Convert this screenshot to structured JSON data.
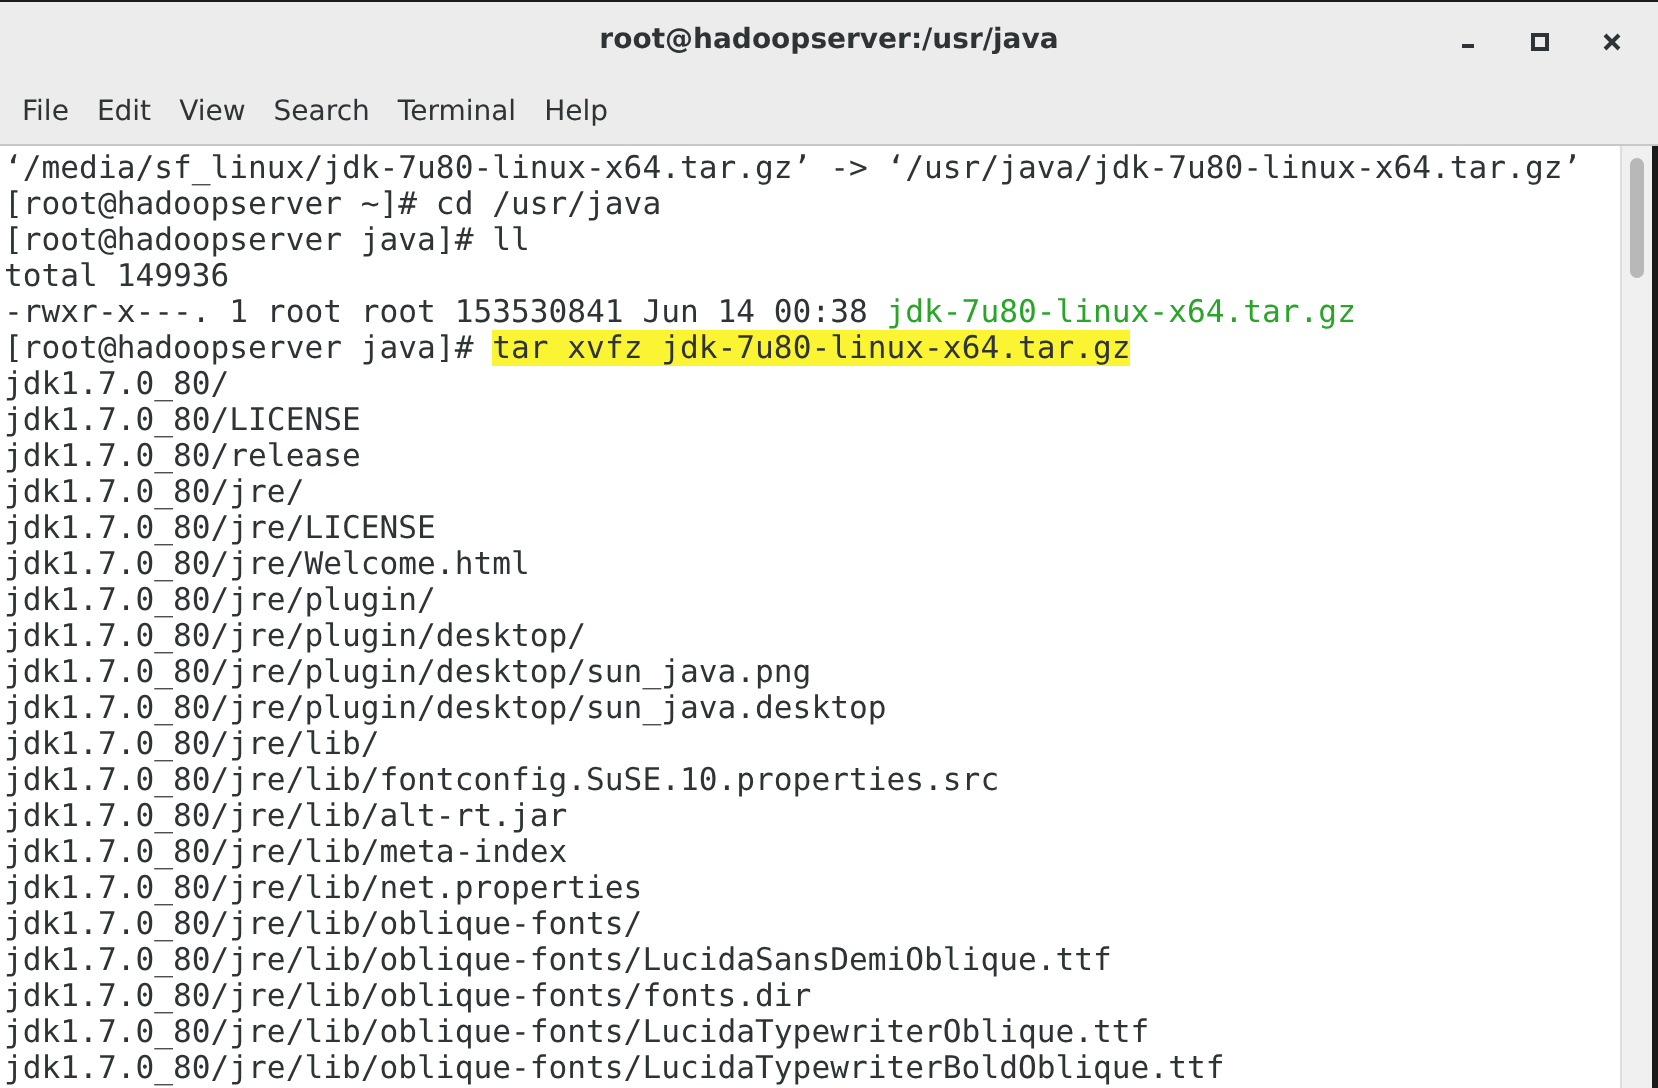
{
  "window": {
    "title": "root@hadoopserver:/usr/java"
  },
  "menu": [
    "File",
    "Edit",
    "View",
    "Search",
    "Terminal",
    "Help"
  ],
  "terminal": {
    "lines": [
      [
        {
          "kind": "text",
          "text": "‘/media/sf_linux/jdk-7u80-linux-x64.tar.gz’ -> ‘/usr/java/jdk-7u80-linux-x64.tar.gz’"
        }
      ],
      [
        {
          "kind": "text",
          "text": "[root@hadoopserver ~]# cd /usr/java"
        }
      ],
      [
        {
          "kind": "text",
          "text": "[root@hadoopserver java]# ll"
        }
      ],
      [
        {
          "kind": "text",
          "text": "total 149936"
        }
      ],
      [
        {
          "kind": "text",
          "text": "-rwxr-x---. 1 root root 153530841 Jun 14 00:38 "
        },
        {
          "kind": "file",
          "text": "jdk-7u80-linux-x64.tar.gz"
        }
      ],
      [
        {
          "kind": "text",
          "text": "[root@hadoopserver java]# "
        },
        {
          "kind": "highlight",
          "text": "tar xvfz jdk-7u80-linux-x64.tar.gz"
        }
      ],
      [
        {
          "kind": "text",
          "text": "jdk1.7.0_80/"
        }
      ],
      [
        {
          "kind": "text",
          "text": "jdk1.7.0_80/LICENSE"
        }
      ],
      [
        {
          "kind": "text",
          "text": "jdk1.7.0_80/release"
        }
      ],
      [
        {
          "kind": "text",
          "text": "jdk1.7.0_80/jre/"
        }
      ],
      [
        {
          "kind": "text",
          "text": "jdk1.7.0_80/jre/LICENSE"
        }
      ],
      [
        {
          "kind": "text",
          "text": "jdk1.7.0_80/jre/Welcome.html"
        }
      ],
      [
        {
          "kind": "text",
          "text": "jdk1.7.0_80/jre/plugin/"
        }
      ],
      [
        {
          "kind": "text",
          "text": "jdk1.7.0_80/jre/plugin/desktop/"
        }
      ],
      [
        {
          "kind": "text",
          "text": "jdk1.7.0_80/jre/plugin/desktop/sun_java.png"
        }
      ],
      [
        {
          "kind": "text",
          "text": "jdk1.7.0_80/jre/plugin/desktop/sun_java.desktop"
        }
      ],
      [
        {
          "kind": "text",
          "text": "jdk1.7.0_80/jre/lib/"
        }
      ],
      [
        {
          "kind": "text",
          "text": "jdk1.7.0_80/jre/lib/fontconfig.SuSE.10.properties.src"
        }
      ],
      [
        {
          "kind": "text",
          "text": "jdk1.7.0_80/jre/lib/alt-rt.jar"
        }
      ],
      [
        {
          "kind": "text",
          "text": "jdk1.7.0_80/jre/lib/meta-index"
        }
      ],
      [
        {
          "kind": "text",
          "text": "jdk1.7.0_80/jre/lib/net.properties"
        }
      ],
      [
        {
          "kind": "text",
          "text": "jdk1.7.0_80/jre/lib/oblique-fonts/"
        }
      ],
      [
        {
          "kind": "text",
          "text": "jdk1.7.0_80/jre/lib/oblique-fonts/LucidaSansDemiOblique.ttf"
        }
      ],
      [
        {
          "kind": "text",
          "text": "jdk1.7.0_80/jre/lib/oblique-fonts/fonts.dir"
        }
      ],
      [
        {
          "kind": "text",
          "text": "jdk1.7.0_80/jre/lib/oblique-fonts/LucidaTypewriterOblique.ttf"
        }
      ],
      [
        {
          "kind": "text",
          "text": "jdk1.7.0_80/jre/lib/oblique-fonts/LucidaTypewriterBoldOblique.ttf"
        }
      ]
    ]
  }
}
